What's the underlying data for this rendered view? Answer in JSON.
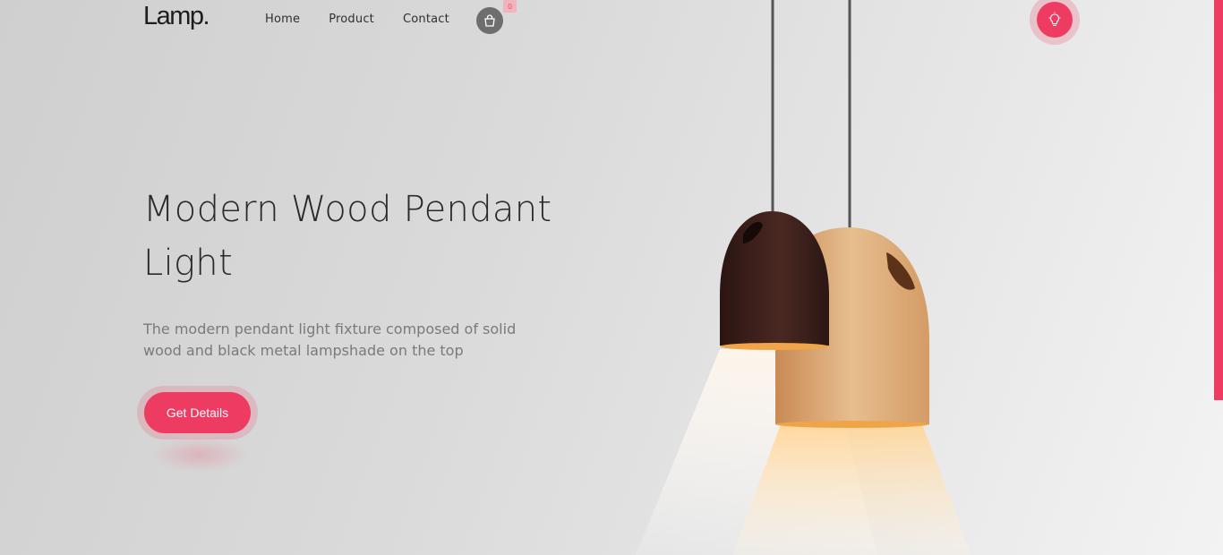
{
  "brand": {
    "logo": "Lamp."
  },
  "nav": {
    "items": [
      "Home",
      "Product",
      "Contact"
    ],
    "cart_count": "0"
  },
  "hero": {
    "title": "Modern Wood Pendant Light",
    "description": "The modern pendant light fixture composed of solid wood and black metal lampshade on the top",
    "cta_label": "Get Details"
  },
  "colors": {
    "accent": "#ee3b62",
    "text": "#2a2a2a",
    "muted": "#7a7a7a",
    "dark_wood": "#3a1f1a",
    "light_wood": "#d9a877"
  },
  "icons": {
    "cart": "shopping-bag-icon",
    "bulb": "lightbulb-icon"
  }
}
